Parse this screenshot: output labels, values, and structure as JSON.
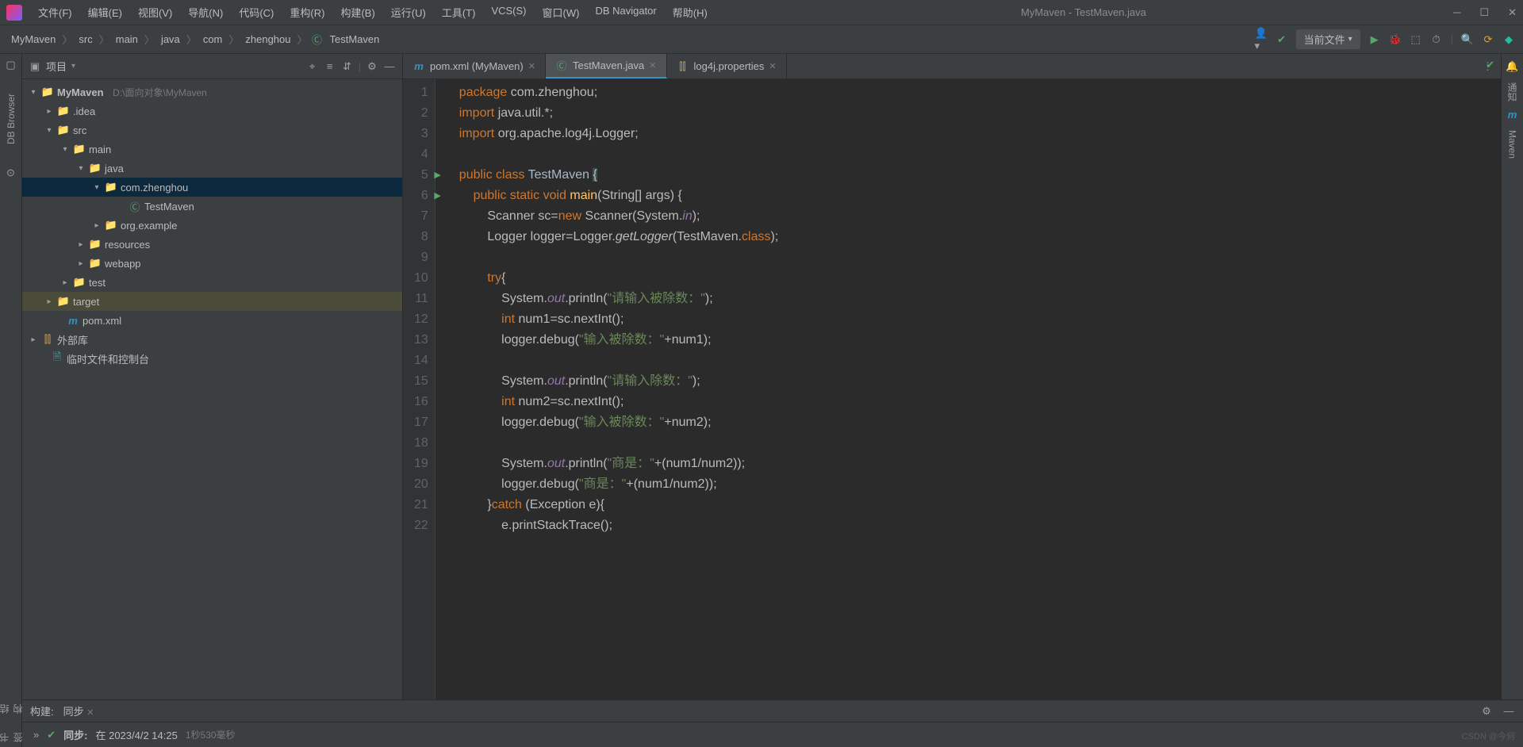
{
  "window": {
    "title": "MyMaven - TestMaven.java"
  },
  "menu": {
    "file": "文件(F)",
    "edit": "编辑(E)",
    "view": "视图(V)",
    "nav": "导航(N)",
    "code": "代码(C)",
    "refactor": "重构(R)",
    "build": "构建(B)",
    "run": "运行(U)",
    "tools": "工具(T)",
    "vcs": "VCS(S)",
    "window": "窗口(W)",
    "dbnav": "DB Navigator",
    "help": "帮助(H)"
  },
  "breadcrumb": [
    "MyMaven",
    "src",
    "main",
    "java",
    "com",
    "zhenghou",
    "TestMaven"
  ],
  "runconfig": "当前文件",
  "project": {
    "label": "项目",
    "root": {
      "name": "MyMaven",
      "path": "D:\\面向对象\\MyMaven"
    },
    "idea": ".idea",
    "src": "src",
    "main": "main",
    "java": "java",
    "pkg": "com.zhenghou",
    "cls": "TestMaven",
    "orgexample": "org.example",
    "resources": "resources",
    "webapp": "webapp",
    "test": "test",
    "target": "target",
    "pom": "pom.xml",
    "external": "外部库",
    "scratch": "临时文件和控制台"
  },
  "tabs": {
    "t0": "pom.xml (MyMaven)",
    "t1": "TestMaven.java",
    "t2": "log4j.properties"
  },
  "code_lines": [
    1,
    2,
    3,
    4,
    5,
    6,
    7,
    8,
    9,
    10,
    11,
    12,
    13,
    14,
    15,
    16,
    17,
    18,
    19,
    20,
    21,
    22
  ],
  "code": {
    "l1": "package com.zhenghou;",
    "l2": "import java.util.*;",
    "l3": "import org.apache.log4j.Logger;",
    "l4": "",
    "l5": "public class TestMaven {",
    "l6": "    public static void main(String[] args) {",
    "l7": "        Scanner sc=new Scanner(System.in);",
    "l8": "        Logger logger=Logger.getLogger(TestMaven.class);",
    "l9": "",
    "l10": "        try{",
    "l11": "            System.out.println(\"请输入被除数：\");",
    "l12": "            int num1=sc.nextInt();",
    "l13": "            logger.debug(\"输入被除数：\"+num1);",
    "l14": "",
    "l15": "            System.out.println(\"请输入除数：\");",
    "l16": "            int num2=sc.nextInt();",
    "l17": "            logger.debug(\"输入被除数：\"+num2);",
    "l18": "",
    "l19": "            System.out.println(\"商是：\"+(num1/num2));",
    "l20": "            logger.debug(\"商是：\"+(num1/num2));",
    "l21": "        }catch (Exception e){",
    "l22": "            e.printStackTrace();"
  },
  "sidebars": {
    "structure": "结构",
    "dbbrowser": "DB Browser",
    "bookmarks": "书签",
    "maven": "Maven",
    "notif": "通知"
  },
  "bottom": {
    "build": "构建:",
    "sync": "同步",
    "sync_status": "同步:",
    "sync_time": "在 2023/4/2 14:25",
    "elapsed": "1秒530毫秒"
  },
  "watermark": "CSDN @今何"
}
